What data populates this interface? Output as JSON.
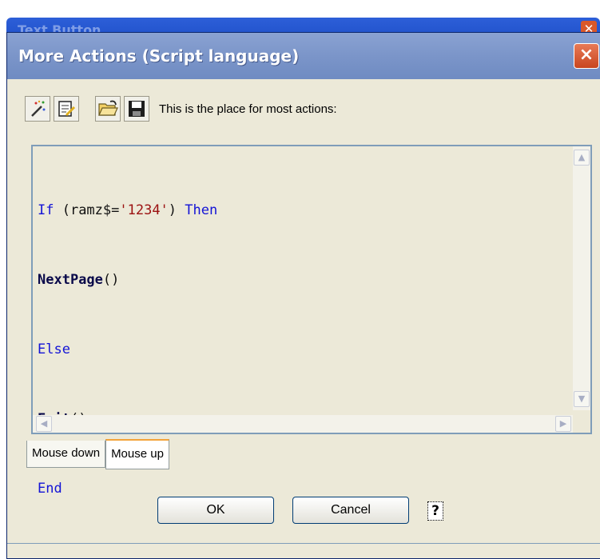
{
  "background_window": {
    "title": "Text Button"
  },
  "dialog": {
    "title": "More Actions (Script language)",
    "close_label": "×"
  },
  "toolbar": {
    "buttons": [
      {
        "name": "wand-icon"
      },
      {
        "name": "edit-page-icon"
      },
      {
        "name": "open-folder-icon"
      },
      {
        "name": "save-disk-icon"
      }
    ],
    "label": "This is the place for most actions:"
  },
  "editor": {
    "lines": [
      {
        "kw1": "If",
        "plain": " (ramz$=",
        "str": "'1234'",
        "plain2": ") ",
        "kw2": "Then"
      },
      {
        "fn": "NextPage",
        "plain": "()"
      },
      {
        "kw": "Else"
      },
      {
        "fn": "Exit",
        "plain": "()"
      },
      {
        "kw": "End"
      }
    ]
  },
  "tabs": [
    {
      "label": "Mouse down",
      "active": false
    },
    {
      "label": "Mouse up",
      "active": true
    }
  ],
  "buttons": {
    "ok": "OK",
    "cancel": "Cancel",
    "help": "?"
  },
  "colors": {
    "keyword": "#1414d6",
    "string": "#9b1111",
    "function": "#0a0a4a",
    "title_bar": "#7b95c9"
  }
}
